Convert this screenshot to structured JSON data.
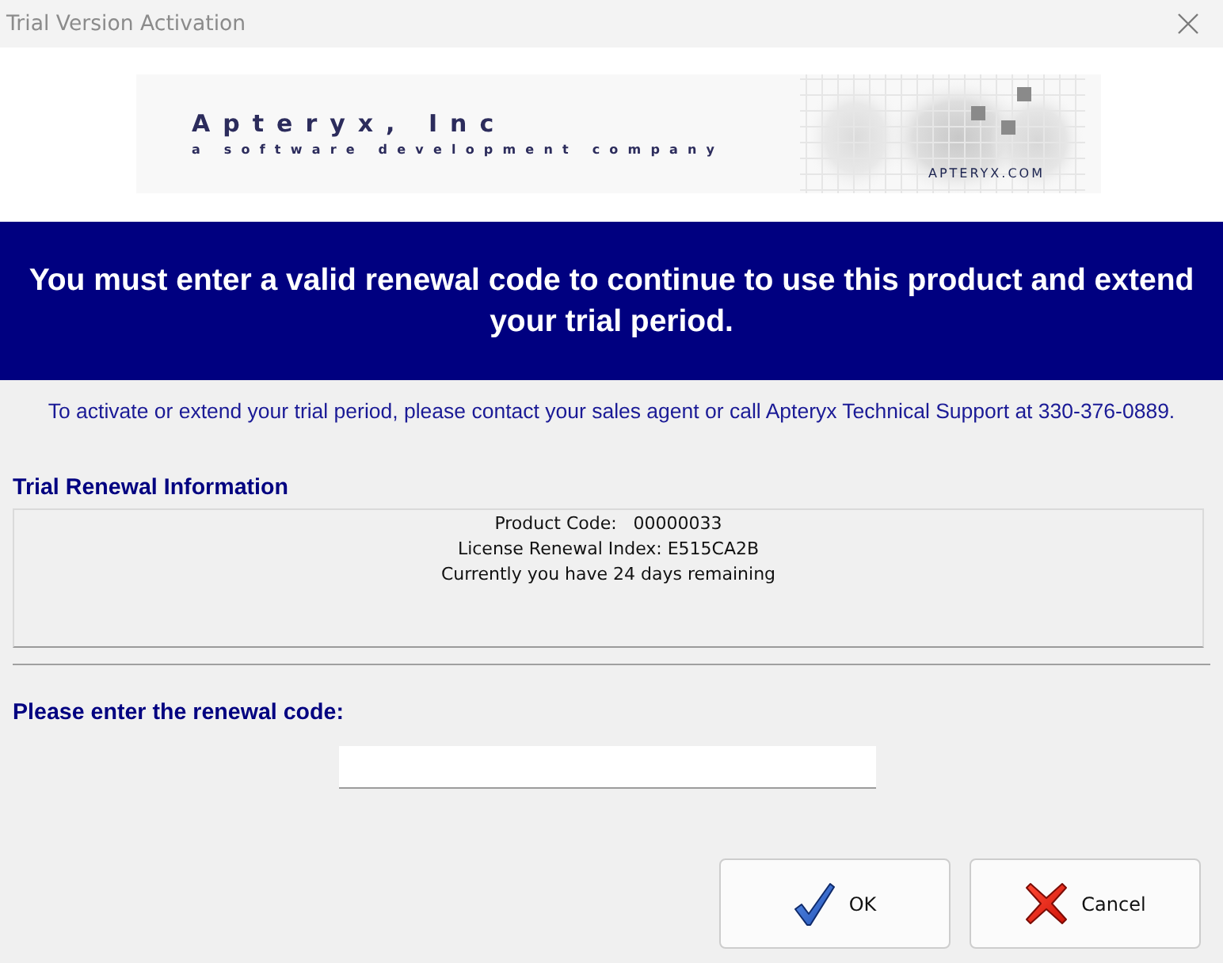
{
  "window": {
    "title": "Trial Version Activation"
  },
  "banner": {
    "company": "Apteryx, Inc",
    "tagline": "a software development company",
    "website": "APTERYX.COM"
  },
  "notice": "You must enter a valid renewal code to continue to use this product and extend your trial period.",
  "contact_text": "To activate or extend your trial period, please contact your sales agent or call Apteryx Technical Support at 330-376-0889.",
  "renewal_info": {
    "heading": "Trial Renewal Information",
    "lines": [
      "Product Code:   00000033",
      "License Renewal Index: E515CA2B",
      "Currently you have 24 days remaining"
    ]
  },
  "code_entry": {
    "label": "Please enter the renewal code:"
  },
  "buttons": [
    {
      "kind": "ok",
      "label": "OK"
    },
    {
      "kind": "cancel",
      "label": "Cancel"
    }
  ]
}
